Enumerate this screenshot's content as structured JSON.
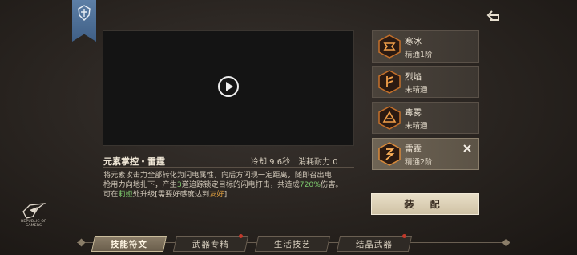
{
  "colors": {
    "highlight_green": "#7dc96d",
    "highlight_orange": "#e0a040",
    "notification": "#c0392b"
  },
  "skill": {
    "title": "元素掌控・雷霆",
    "cooldown": "冷却 9.6秒",
    "cost": "消耗耐力 0",
    "desc": {
      "p1": "将元素攻击力全部转化为闪电属性，向后方闪现一定距离，随即召出电",
      "p2a": "枪用力向地扎下，产生",
      "p2b": "3",
      "p2c": "道追踪锁定目标的闪电打击，共造成",
      "p2d": "720%",
      "p2e": "伤害。",
      "p3a": "可在",
      "p3b": "莉娅",
      "p3c": "处升级[需要好感度达到",
      "p3d": "友好",
      "p3e": "]"
    }
  },
  "runes": [
    {
      "name": "寒冰",
      "status": "精通1阶",
      "icon": "frost-rune-icon"
    },
    {
      "name": "烈焰",
      "status": "未精通",
      "icon": "flame-rune-icon"
    },
    {
      "name": "毒雾",
      "status": "未精通",
      "icon": "poison-rune-icon"
    },
    {
      "name": "雷霆",
      "status": "精通2阶",
      "icon": "thunder-rune-icon"
    }
  ],
  "equip_label": "装 配",
  "logo": {
    "line1": "REPUBLIC OF",
    "line2": "GAMERS"
  },
  "tabs": [
    {
      "label": "技能符文",
      "active": true,
      "badge": false
    },
    {
      "label": "武器专精",
      "active": false,
      "badge": true
    },
    {
      "label": "生活技艺",
      "active": false,
      "badge": false
    },
    {
      "label": "结晶武器",
      "active": false,
      "badge": true
    }
  ]
}
